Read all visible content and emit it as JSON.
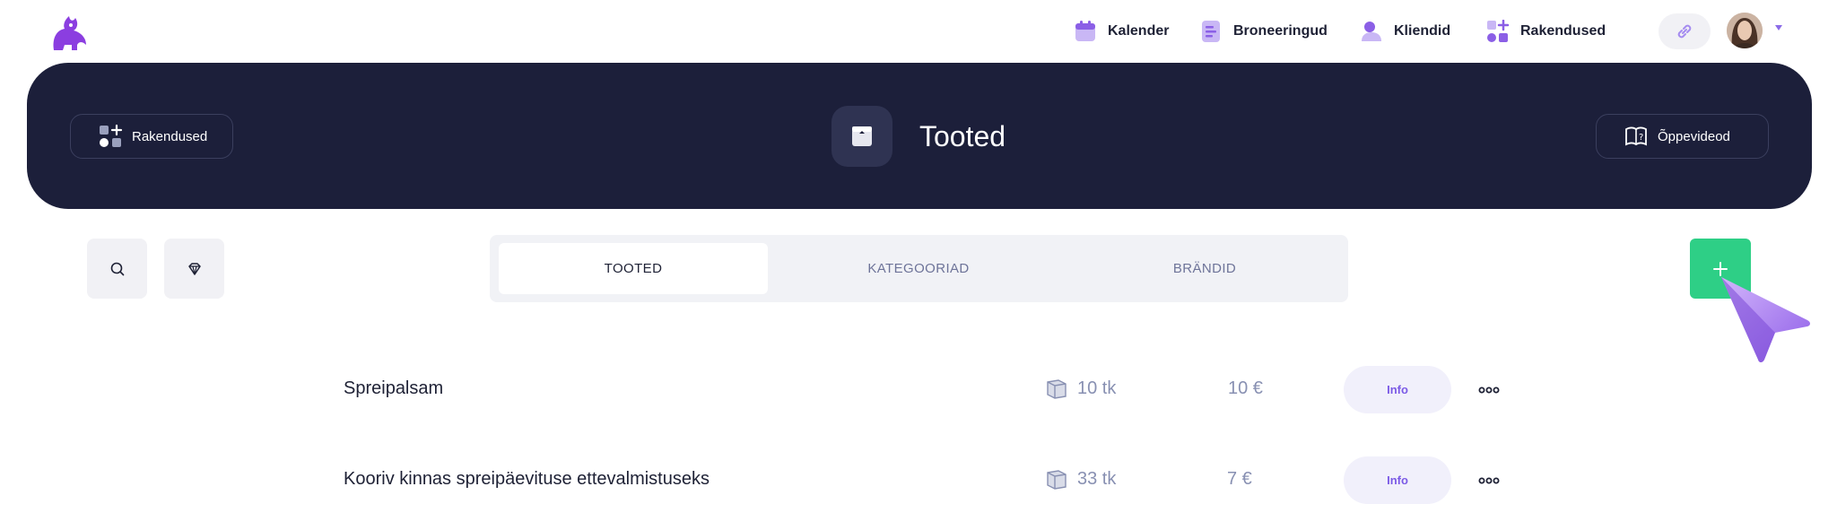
{
  "topbar": {
    "nav": [
      {
        "label": "Kalender",
        "icon": "calendar-icon"
      },
      {
        "label": "Broneeringud",
        "icon": "bookings-icon"
      },
      {
        "label": "Kliendid",
        "icon": "clients-icon"
      },
      {
        "label": "Rakendused",
        "icon": "apps-icon"
      }
    ],
    "link_icon": "link-icon",
    "caret_icon": "caret-down-icon"
  },
  "hero": {
    "apps_button": "Rakendused",
    "title": "Tooted",
    "videos_button": "Õppevideod"
  },
  "tabs": [
    {
      "label": "TOOTED",
      "active": true
    },
    {
      "label": "KATEGOORIAD",
      "active": false
    },
    {
      "label": "BRÄNDID",
      "active": false
    }
  ],
  "products": [
    {
      "name": "Spreipalsam",
      "stock": "10 tk",
      "price": "10 €",
      "info": "Info"
    },
    {
      "name": "Kooriv kinnas spreipäevituse ettevalmistuseks",
      "stock": "33 tk",
      "price": "7 €",
      "info": "Info"
    }
  ],
  "colors": {
    "brand": "#8b3ee0",
    "hero_bg": "#1c1f3a",
    "add_button": "#2ecf86",
    "accent_purple": "#7b5ae6"
  }
}
